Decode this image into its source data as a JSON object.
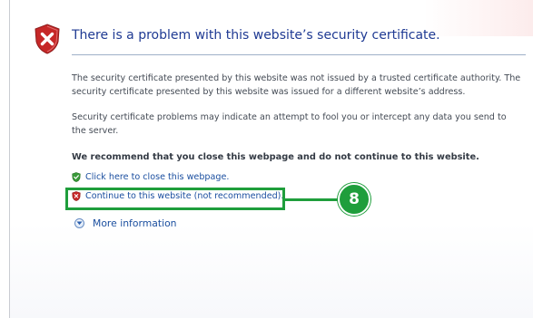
{
  "page": {
    "title": "There is a problem with this website’s security certificate.",
    "paragraph1": "The security certificate presented by this website was not issued by a trusted certificate authority. The security certificate presented by this website was issued for a different website’s address.",
    "paragraph2": "Security certificate problems may indicate an attempt to fool you or intercept any data you send to the server.",
    "recommendation": "We recommend that you close this webpage and do not continue to this website.",
    "close_link": "Click here to close this webpage.",
    "continue_link": "Continue to this website (not recommended).",
    "more_info": "More information"
  },
  "annotation": {
    "step_number": "8",
    "color": "#1f9e3c"
  },
  "icons": {
    "header": "error-shield-icon",
    "close": "green-shield-icon",
    "continue": "red-shield-icon",
    "more": "expand-arrow-icon"
  }
}
